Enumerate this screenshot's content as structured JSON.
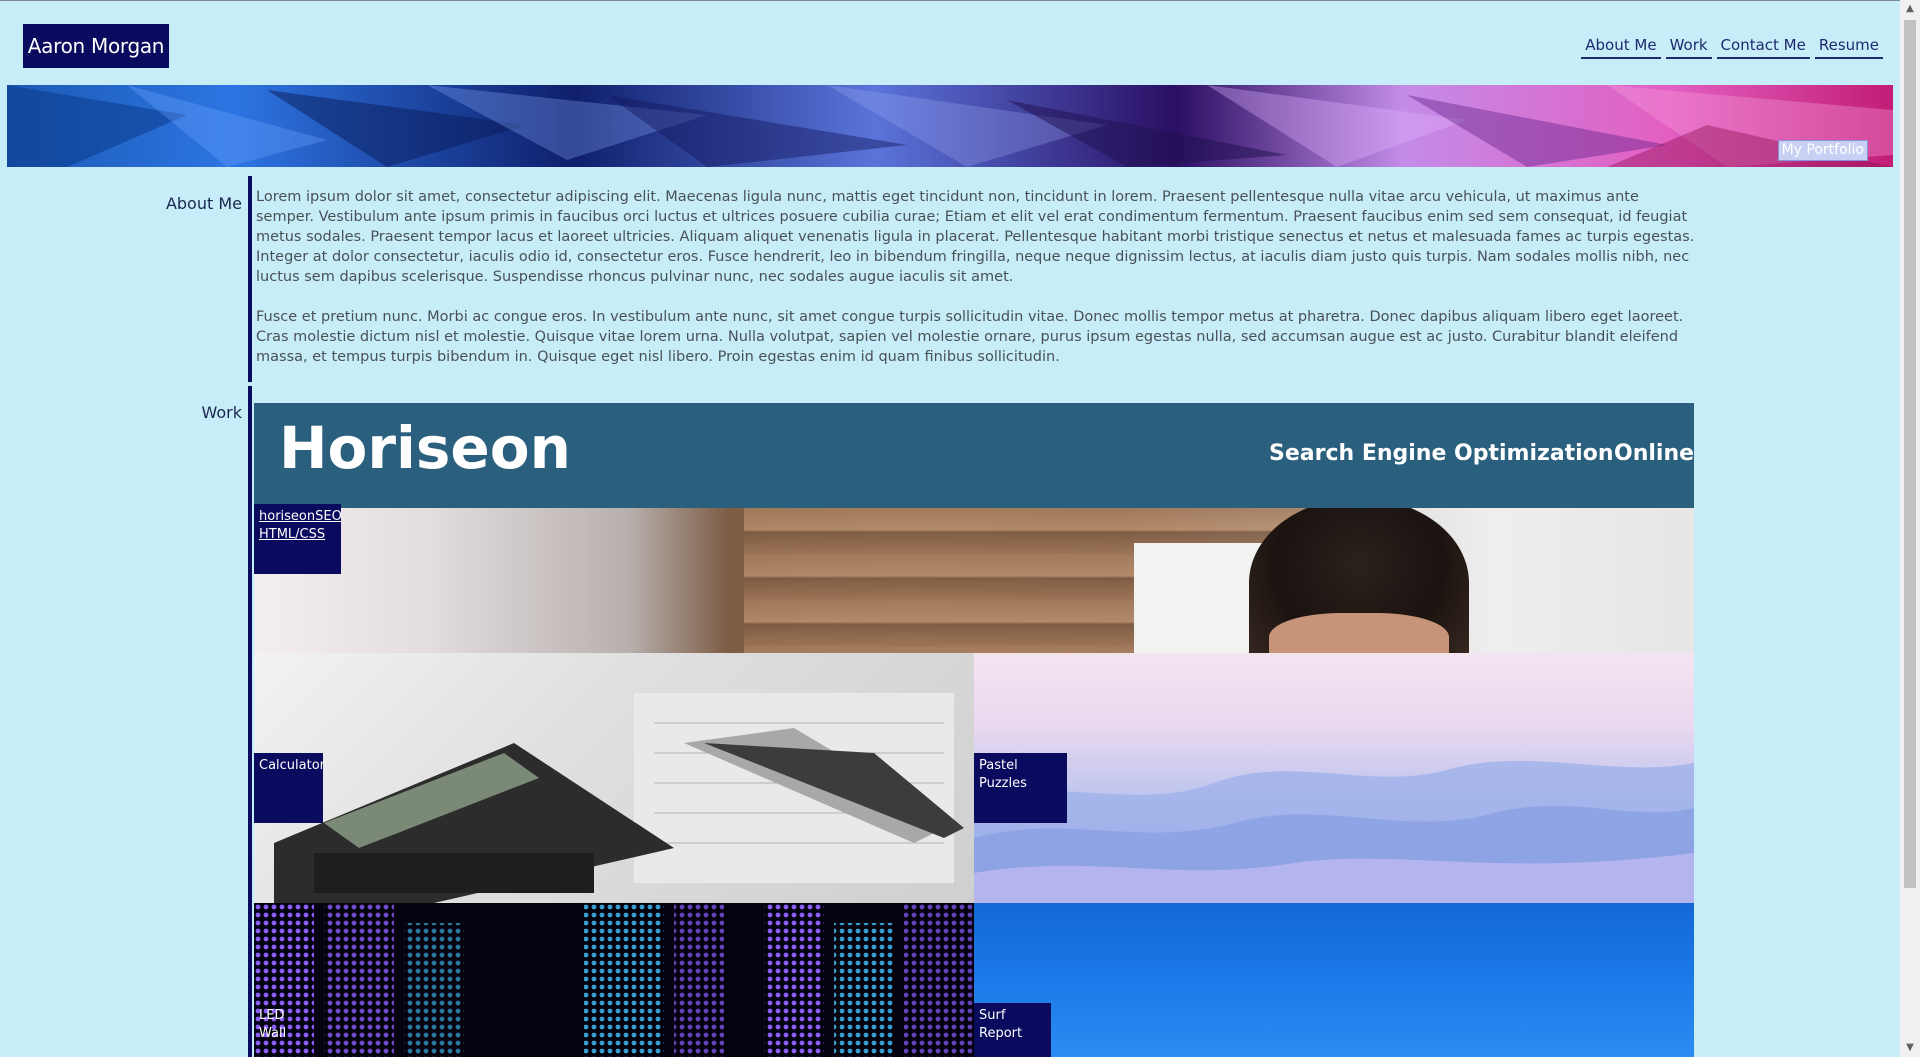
{
  "brand": "Aaron Morgan",
  "nav": [
    "About Me",
    "Work",
    "Contact Me",
    "Resume"
  ],
  "hero": {
    "badge": "My Portfolio"
  },
  "about": {
    "label": "About Me",
    "paragraphs": [
      "Lorem ipsum dolor sit amet, consectetur adipiscing elit. Maecenas ligula nunc, mattis eget tincidunt non, tincidunt in lorem. Praesent pellentesque nulla vitae arcu vehicula, ut maximus ante semper. Vestibulum ante ipsum primis in faucibus orci luctus et ultrices posuere cubilia curae; Etiam et elit vel erat condimentum fermentum. Praesent faucibus enim sed sem consequat, id feugiat metus sodales. Praesent tempor lacus et laoreet ultricies. Aliquam aliquet venenatis ligula in placerat. Pellentesque habitant morbi tristique senectus et netus et malesuada fames ac turpis egestas. Integer at dolor consectetur, iaculis odio id, consectetur eros. Fusce hendrerit, leo in bibendum fringilla, neque neque dignissim lectus, at iaculis diam justo quis turpis. Nam sodales mollis nibh, nec luctus sem dapibus scelerisque. Suspendisse rhoncus pulvinar nunc, nec sodales augue iaculis sit amet.",
      "Fusce et pretium nunc. Morbi ac congue eros. In vestibulum ante nunc, sit amet congue turpis sollicitudin vitae. Donec mollis tempor metus at pharetra. Donec dapibus aliquam libero eget laoreet. Cras molestie dictum nisl et molestie. Quisque vitae lorem urna. Nulla volutpat, sapien vel molestie ornare, purus ipsum egestas nulla, sed accumsan augue est ac justo. Curabitur blandit eleifend massa, et tempus turpis bibendum in. Quisque eget nisl libero. Proin egestas enim id quam finibus sollicitudin."
    ]
  },
  "work": {
    "label": "Work",
    "featured": {
      "logo": "Horiseon",
      "nav": [
        "Search Engine Optimization",
        "Online"
      ],
      "tag_line1": "horiseonSEO",
      "tag_line2": "HTML/CSS"
    },
    "projects": [
      "Calculator",
      "Pastel Puzzles",
      "LED Wall",
      "Surf Report"
    ]
  },
  "colors": {
    "background": "#c7eef8",
    "accent": "#0a0a5e",
    "featured_header": "#2a5f7e"
  }
}
